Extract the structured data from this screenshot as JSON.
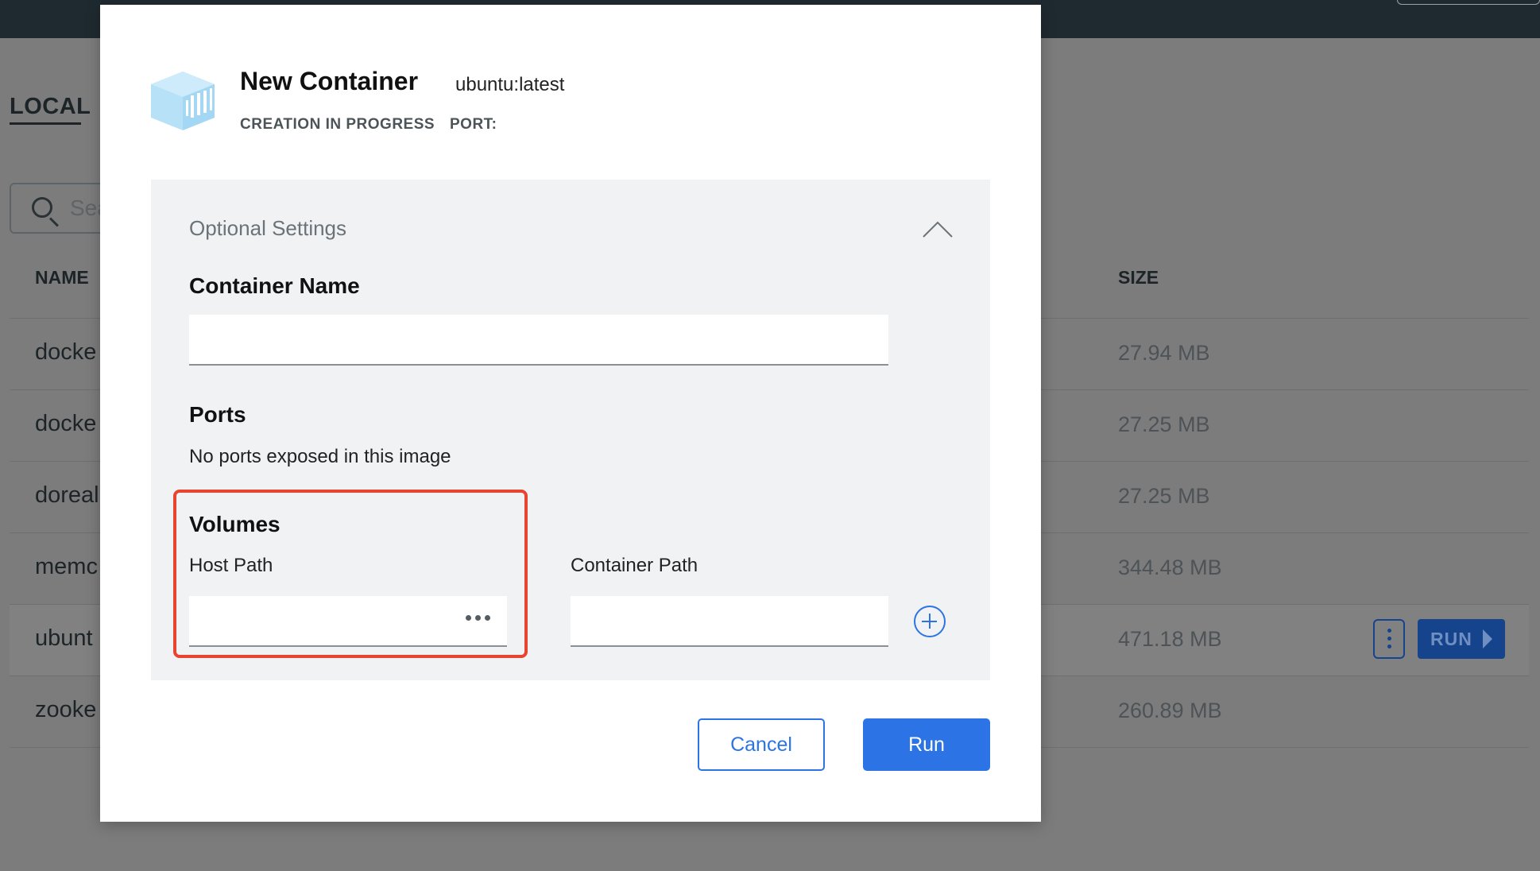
{
  "background": {
    "tab_local": "LOCAL",
    "search_placeholder": "Sea",
    "columns": {
      "name": "NAME",
      "size": "SIZE"
    },
    "rows": [
      {
        "name": "docke",
        "size": "27.94 MB"
      },
      {
        "name": "docke",
        "size": "27.25 MB"
      },
      {
        "name": "doreal",
        "size": "27.25 MB"
      },
      {
        "name": "memc",
        "size": "344.48 MB"
      },
      {
        "name": "ubunt",
        "size": "471.18 MB"
      },
      {
        "name": "zooke",
        "size": "260.89 MB"
      }
    ],
    "run_label": "RUN"
  },
  "modal": {
    "title": "New Container",
    "image": "ubuntu:latest",
    "status": "CREATION IN PROGRESS",
    "port_label": "PORT:",
    "optional_settings": {
      "title": "Optional Settings",
      "container_name_label": "Container Name",
      "container_name_value": "",
      "ports_label": "Ports",
      "ports_text": "No ports exposed in this image",
      "volumes_label": "Volumes",
      "host_path_label": "Host Path",
      "host_path_value": "",
      "container_path_label": "Container Path",
      "container_path_value": ""
    },
    "cancel_label": "Cancel",
    "run_label": "Run"
  },
  "colors": {
    "accent": "#2c74e6",
    "highlight": "#e8442f"
  }
}
